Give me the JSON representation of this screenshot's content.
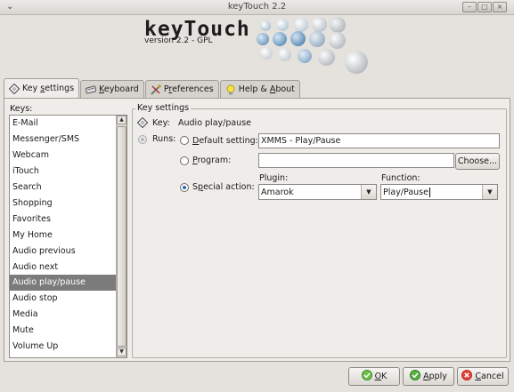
{
  "window": {
    "title": "keyTouch 2.2",
    "menu_icon": "chevron-down-icon",
    "buttons": [
      "minimize-icon",
      "maximize-icon",
      "close-icon"
    ]
  },
  "logo": {
    "text": "keyTouch",
    "version": "version 2.2 - GPL"
  },
  "tabs": [
    {
      "label": "Key settings",
      "mnemonic": "s",
      "icon": "key-settings-icon",
      "active": true
    },
    {
      "label": "Keyboard",
      "mnemonic": "K",
      "icon": "keyboard-icon"
    },
    {
      "label": "Preferences",
      "mnemonic": "r",
      "icon": "preferences-icon"
    },
    {
      "label": "Help & About",
      "mnemonic": "A",
      "icon": "help-bulb-icon"
    }
  ],
  "keys": {
    "label": "Keys:",
    "items": [
      "E-Mail",
      "Messenger/SMS",
      "Webcam",
      "iTouch",
      "Search",
      "Shopping",
      "Favorites",
      "My Home",
      "Audio previous",
      "Audio next",
      "Audio play/pause",
      "Audio stop",
      "Media",
      "Mute",
      "Volume Up"
    ],
    "selected": "Audio play/pause"
  },
  "settings": {
    "title": "Key settings",
    "key_label": "Key:",
    "key_value": "Audio play/pause",
    "runs_label": "Runs:",
    "default_label": "Default setting:",
    "default_value": "XMMS - Play/Pause",
    "program_label": "Program:",
    "program_value": "",
    "choose_label": "Choose...",
    "special_label": "Special action:",
    "selected_option": "Special action",
    "plugin_label": "Plugin:",
    "plugin_value": "Amarok",
    "function_label": "Function:",
    "function_value": "Play/Pause"
  },
  "footer": {
    "ok": "OK",
    "apply": "Apply",
    "cancel": "Cancel",
    "colors": {
      "ok_icon": "#3d8f2e",
      "apply_icon": "#2f7d24",
      "cancel_icon": "#c4251e"
    }
  }
}
